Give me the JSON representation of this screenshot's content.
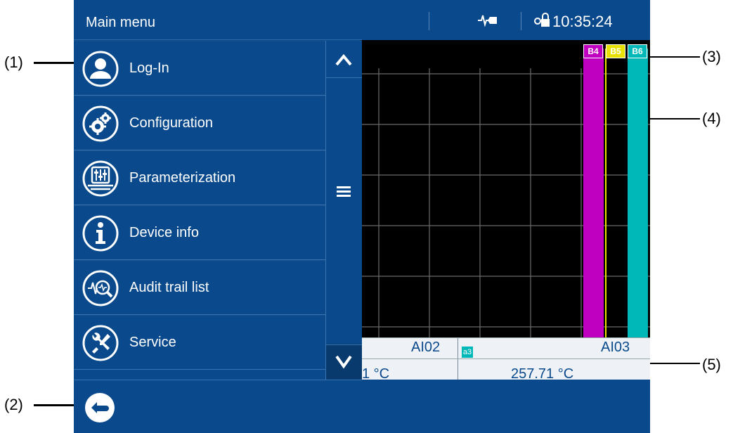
{
  "menu": {
    "title": "Main menu",
    "items": [
      {
        "label": "Log-In",
        "icon": "user-icon"
      },
      {
        "label": "Configuration",
        "icon": "gears-icon"
      },
      {
        "label": "Parameterization",
        "icon": "sliders-icon"
      },
      {
        "label": "Device info",
        "icon": "info-icon"
      },
      {
        "label": "Audit trail list",
        "icon": "audit-trail-icon"
      },
      {
        "label": "Service",
        "icon": "tools-icon"
      }
    ],
    "back_icon": "back-arrow-icon"
  },
  "status": {
    "time": "10:35:24",
    "icons": [
      "signal-icon",
      "lock-icon"
    ]
  },
  "chart": {
    "channel_tags": [
      "B4",
      "B5",
      "B6"
    ],
    "values": {
      "left_label": "AI02",
      "right_label": "AI03",
      "badge": "a3",
      "left_value": "1 °C",
      "right_value": "257.71 °C"
    }
  },
  "callouts": [
    "(1)",
    "(2)",
    "(3)",
    "(4)",
    "(5)"
  ],
  "colors": {
    "panel_blue": "#0a4a8c",
    "magenta_bar": "#c000c0",
    "yellow_line": "#e8e000",
    "cyan_bar": "#00b8b8"
  }
}
